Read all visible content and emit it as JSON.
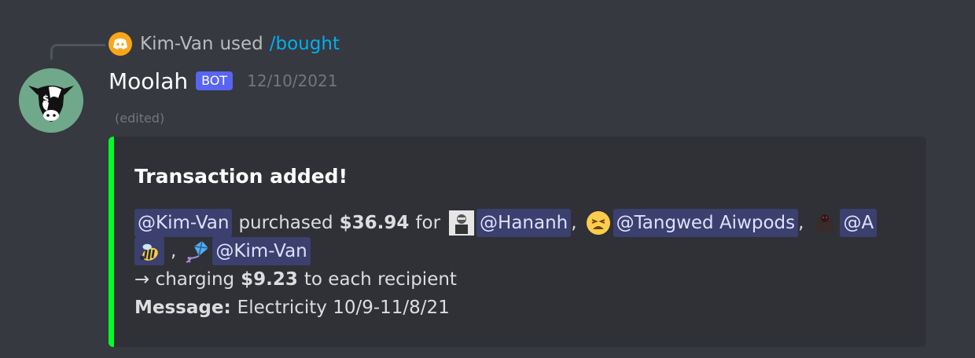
{
  "reply": {
    "author": "Kim-Van",
    "used": "used",
    "command": "/bought"
  },
  "message": {
    "username": "Moolah",
    "bot_tag": "BOT",
    "timestamp": "12/10/2021",
    "edited": "(edited)"
  },
  "embed": {
    "accent_color": "#00ff2a",
    "title": "Transaction added!",
    "line1": {
      "payer": "@Kim-Van",
      "purchased": "purchased",
      "amount": "$36.94",
      "for": "for",
      "recipient1": "@Hananh",
      "comma1": ",",
      "recipient2": "@Tangwed Aiwpods",
      "comma2": ",",
      "recipient3": "@A"
    },
    "line2": {
      "comma": ",",
      "recipient4": "@Kim-Van"
    },
    "line3": {
      "arrow_text": "→ charging",
      "amount": "$9.23",
      "suffix": "to each recipient"
    },
    "line4": {
      "label": "Message:",
      "value": "Electricity 10/9-11/8/21"
    }
  },
  "icons": {
    "reply_app": "discord-icon",
    "avatar": "cow-money-icon",
    "recipient1": "avatar-icon",
    "recipient2": "weary-face-emoji",
    "recipient3": "bug-emoji",
    "recipient3_tail": "bee-emoji",
    "recipient4": "kite-emoji"
  },
  "colors": {
    "background": "#36393f",
    "embed_bg": "#2f3136",
    "link": "#00aff4",
    "bot_tag": "#5865f2"
  }
}
